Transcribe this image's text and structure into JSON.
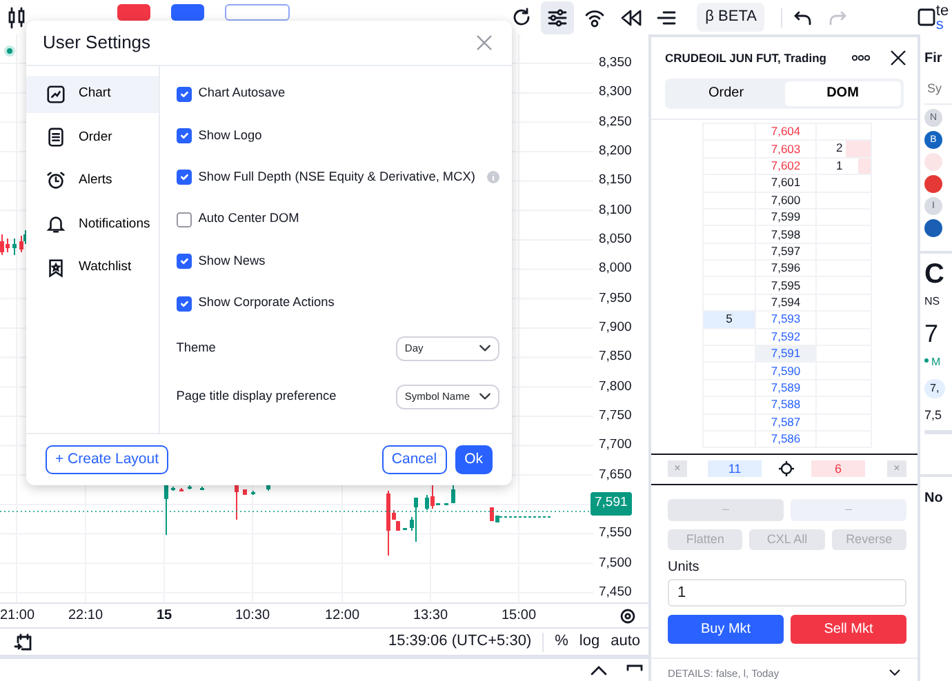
{
  "toolbar": {
    "tools": [
      {
        "kind": "refresh",
        "selected": false
      },
      {
        "kind": "sliders",
        "selected": true
      },
      {
        "kind": "broadcast",
        "selected": false
      },
      {
        "kind": "rewind",
        "selected": false
      },
      {
        "kind": "lines",
        "selected": false
      }
    ],
    "badge": "β BETA",
    "account": "te",
    "account_sub": "s"
  },
  "chart": {
    "price_ticks_upper": [
      "8,350",
      "8,300",
      "8,250",
      "8,200",
      "8,150",
      "8,100",
      "8,050",
      "8,000",
      "7,950",
      "7,900",
      "7,850",
      "7,800",
      "7,750",
      "7,700",
      "7,650"
    ],
    "last_price": "7,591",
    "price_ticks_lower": [
      "7,550",
      "7,500",
      "7,450"
    ],
    "time_ticks": [
      {
        "label": "21:00",
        "kind": "time"
      },
      {
        "label": "22:10",
        "kind": "time"
      },
      {
        "label": "15",
        "kind": "date"
      },
      {
        "label": "10:30",
        "kind": "time"
      },
      {
        "label": "12:00",
        "kind": "time"
      },
      {
        "label": "13:30",
        "kind": "time"
      },
      {
        "label": "15:00",
        "kind": "time"
      }
    ],
    "timestamp": "15:39:06 (UTC+5:30)",
    "scale_buttons": [
      "%",
      "log",
      "auto"
    ]
  },
  "settings_dialog": {
    "title": "User Settings",
    "nav": [
      {
        "label": "Chart",
        "kind": "chart",
        "selected": true
      },
      {
        "label": "Order",
        "kind": "order",
        "selected": false
      },
      {
        "label": "Alerts",
        "kind": "alerts",
        "selected": false
      },
      {
        "label": "Notifications",
        "kind": "notifications",
        "selected": false
      },
      {
        "label": "Watchlist",
        "kind": "watchlist",
        "selected": false
      }
    ],
    "options": [
      {
        "label": "Chart Autosave",
        "checked": true,
        "info": false
      },
      {
        "label": "Show Logo",
        "checked": true,
        "info": false
      },
      {
        "label": "Show Full Depth (NSE Equity & Derivative, MCX)",
        "checked": true,
        "info": true
      },
      {
        "label": "Auto Center DOM",
        "checked": false,
        "info": false
      },
      {
        "label": "Show News",
        "checked": true,
        "info": false
      },
      {
        "label": "Show Corporate Actions",
        "checked": true,
        "info": false
      }
    ],
    "selects": [
      {
        "label": "Theme",
        "value": "Day"
      },
      {
        "label": "Page title display preference",
        "value": "Symbol Name"
      }
    ],
    "create_button": "+ Create Layout",
    "cancel_button": "Cancel",
    "ok_button": "Ok"
  },
  "trade_panel": {
    "title": "CRUDEOIL JUN FUT, Trading",
    "tabs": [
      {
        "label": "Order",
        "selected": false
      },
      {
        "label": "DOM",
        "selected": true
      }
    ],
    "ladder": [
      {
        "price": "7,604",
        "kind": "ask",
        "current": false
      },
      {
        "price": "7,603",
        "kind": "ask",
        "current": false,
        "ask_qty": "2",
        "level": 0.45
      },
      {
        "price": "7,602",
        "kind": "ask",
        "current": false,
        "ask_qty": "1",
        "level": 0.22
      },
      {
        "price": "7,601",
        "kind": "mid",
        "current": false
      },
      {
        "price": "7,600",
        "kind": "mid",
        "current": false
      },
      {
        "price": "7,599",
        "kind": "mid",
        "current": false
      },
      {
        "price": "7,598",
        "kind": "mid",
        "current": false
      },
      {
        "price": "7,597",
        "kind": "mid",
        "current": false
      },
      {
        "price": "7,596",
        "kind": "mid",
        "current": false
      },
      {
        "price": "7,595",
        "kind": "mid",
        "current": false
      },
      {
        "price": "7,594",
        "kind": "mid",
        "current": false
      },
      {
        "price": "7,593",
        "kind": "bid",
        "current": false,
        "bid_qty": "5"
      },
      {
        "price": "7,592",
        "kind": "bid",
        "current": false
      },
      {
        "price": "7,591",
        "kind": "bid",
        "current": true
      },
      {
        "price": "7,590",
        "kind": "bid",
        "current": false
      },
      {
        "price": "7,589",
        "kind": "bid",
        "current": false
      },
      {
        "price": "7,588",
        "kind": "bid",
        "current": false
      },
      {
        "price": "7,587",
        "kind": "bid",
        "current": false
      },
      {
        "price": "7,586",
        "kind": "bid",
        "current": false
      }
    ],
    "bid_total": "11",
    "ask_total": "6",
    "clear_bids": "×",
    "clear_asks": "×",
    "position_buttons": [
      {
        "label": "–",
        "kind": "buy",
        "disabled": true
      },
      {
        "label": "–",
        "kind": "sell",
        "disabled": true
      }
    ],
    "actions": [
      {
        "label": "Flatten",
        "disabled": true
      },
      {
        "label": "CXL All",
        "disabled": true
      },
      {
        "label": "Reverse",
        "disabled": true
      }
    ],
    "units_label": "Units",
    "units_value": "1",
    "buy_button": "Buy Mkt",
    "sell_button": "Sell Mkt",
    "details": "DETAILS: false, l, Today"
  },
  "side_panel": {
    "title": "Fir",
    "search_placeholder": "Sy",
    "avatars": [
      {
        "letter": "N",
        "color": "#d9dce3"
      },
      {
        "letter": "B",
        "color": "#1565c0"
      },
      {
        "color": "#fbe4e6"
      },
      {
        "color": "#e53935"
      },
      {
        "letter": "I",
        "color": "#d9dce3"
      },
      {
        "color": "#1a5fb4"
      }
    ],
    "symbol": "C",
    "exchange": "NS",
    "price": "7",
    "status": "M",
    "chip": "7,",
    "value": "7,5",
    "section": "No"
  }
}
